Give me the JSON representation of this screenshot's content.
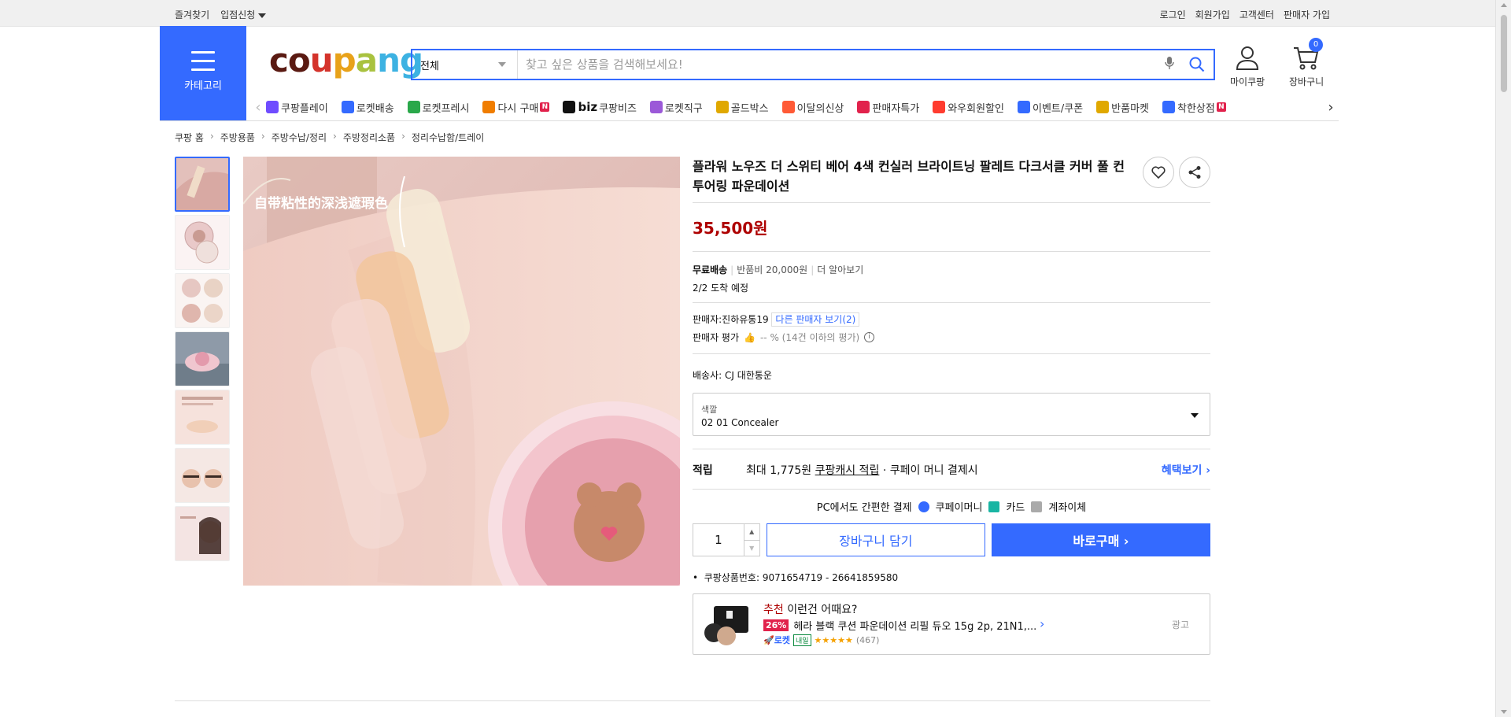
{
  "topbar": {
    "left": [
      "즐겨찾기",
      "입점신청"
    ],
    "right": [
      "로그인",
      "회원가입",
      "고객센터",
      "판매자 가입"
    ]
  },
  "header": {
    "category_label": "카테고리",
    "logo": [
      "c",
      "o",
      "u",
      "p",
      "a",
      "n",
      "g"
    ],
    "search_scope": "전체",
    "search_placeholder": "찾고 싶은 상품을 검색해보세요!",
    "mycoupang": "마이쿠팡",
    "cart": "장바구니",
    "cart_count": "0"
  },
  "colors": {
    "accent": "#346aff",
    "price": "#ae0000",
    "logo": [
      "#5a1a12",
      "#5a1a12",
      "#d4332b",
      "#e8a21a",
      "#a9c23f",
      "#3db2e2",
      "#3db2e2"
    ]
  },
  "catnav": [
    {
      "label": "쿠팡플레이",
      "icon": "play-icon",
      "color": "#6f4cff"
    },
    {
      "label": "로켓배송",
      "icon": "rocket-icon",
      "color": "#346aff"
    },
    {
      "label": "로켓프레시",
      "icon": "rocket-fresh-icon",
      "color": "#2aa84a"
    },
    {
      "label": "다시 구매",
      "icon": "rebuy-icon",
      "color": "#f07d00",
      "badge": "N"
    },
    {
      "label": "쿠팡비즈",
      "prefix": "biz",
      "icon": "biz-icon",
      "color": "#111111"
    },
    {
      "label": "로켓직구",
      "icon": "global-icon",
      "color": "#9b59d8"
    },
    {
      "label": "골드박스",
      "icon": "goldbox-icon",
      "color": "#e0a800"
    },
    {
      "label": "이달의신상",
      "icon": "new-icon",
      "color": "#ff5a36"
    },
    {
      "label": "판매자특가",
      "icon": "percent-icon",
      "color": "#e1224c"
    },
    {
      "label": "와우회원할인",
      "icon": "wow-icon",
      "color": "#ff3c2f"
    },
    {
      "label": "이벤트/쿠폰",
      "icon": "coupon-icon",
      "color": "#346aff"
    },
    {
      "label": "반품마켓",
      "icon": "market-icon",
      "color": "#e0a800"
    },
    {
      "label": "착한상점",
      "icon": "store-icon",
      "color": "#346aff",
      "badge": "N"
    }
  ],
  "breadcrumb": [
    "쿠팡 홈",
    "주방용품",
    "주방수납/정리",
    "주방정리소품",
    "정리수납함/트레이"
  ],
  "product": {
    "title": "플라워 노우즈 더 스위티 베어 4색 컨실러 브라이트닝 팔레트 다크서클 커버 풀 컨투어링 파운데이션",
    "price": "35,500원",
    "image_caption": "自带粘性的深浅遮瑕色",
    "shipping_free": "무료배송",
    "return_fee": "반품비 20,000원",
    "more": "더 알아보기",
    "arrival": "2/2 도착 예정",
    "seller": "판매자:진하유통19",
    "other_sellers": "다른 판매자 보기(2)",
    "seller_rating_label": "판매자 평가",
    "seller_rating_value": "-- % (14건 이하의 평가)",
    "courier": "배송사:  CJ 대한통운",
    "option_label": "색깔",
    "option_value": "02 01 Concealer",
    "cash_label": "적립",
    "cash_max": "최대 1,775원",
    "cash_link": "쿠팡캐시 적립",
    "cash_suffix": "· 쿠페이 머니 결제시",
    "benefit_link": "혜택보기",
    "pay_title": "PC에서도 간편한 결제",
    "pay_methods": [
      "쿠페이머니",
      "카드",
      "계좌이체"
    ],
    "quantity": "1",
    "cart_button": "장바구니 담기",
    "buy_button": "바로구매",
    "product_no": "쿠팡상품번호: 9071654719 - 26641859580"
  },
  "recommend": {
    "title_red": "추천",
    "title_rest": "이런건 어때요?",
    "discount": "26%",
    "name": "헤라 블랙 쿠션 파운데이션 리필 듀오 15g 2p, 21N1,...",
    "rocket": "로켓",
    "naeil": "내일",
    "stars": "★★★★★",
    "count": "(467)",
    "ad": "광고"
  }
}
